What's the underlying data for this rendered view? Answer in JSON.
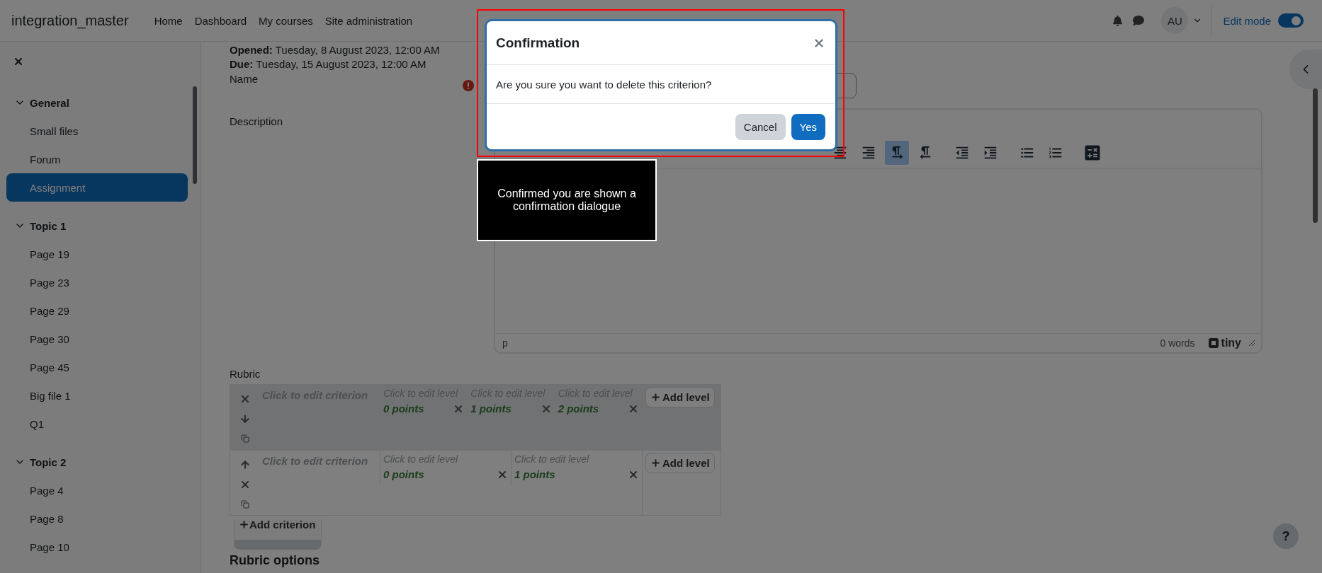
{
  "header": {
    "site_name": "integration_master",
    "nav": [
      "Home",
      "Dashboard",
      "My courses",
      "Site administration"
    ],
    "avatar_initials": "AU",
    "edit_mode": {
      "label": "Edit mode",
      "on": true
    }
  },
  "sidebar": {
    "sections": [
      {
        "title": "General",
        "expanded": true,
        "items": [
          {
            "label": "Small files",
            "selected": false
          },
          {
            "label": "Forum",
            "selected": false
          },
          {
            "label": "Assignment",
            "selected": true
          }
        ]
      },
      {
        "title": "Topic 1",
        "expanded": true,
        "items": [
          {
            "label": "Page 19",
            "selected": false
          },
          {
            "label": "Page 23",
            "selected": false
          },
          {
            "label": "Page 29",
            "selected": false
          },
          {
            "label": "Page 30",
            "selected": false
          },
          {
            "label": "Page 45",
            "selected": false
          },
          {
            "label": "Big file 1",
            "selected": false
          },
          {
            "label": "Q1",
            "selected": false
          }
        ]
      },
      {
        "title": "Topic 2",
        "expanded": true,
        "items": [
          {
            "label": "Page 4",
            "selected": false
          },
          {
            "label": "Page 8",
            "selected": false
          },
          {
            "label": "Page 10",
            "selected": false
          }
        ]
      }
    ]
  },
  "dates": [
    "**Opened:** Tuesday, 8 August 2023, 12:00 AM",
    "**Due:** Tuesday, 15 August 2023, 12:00 AM"
  ],
  "form": {
    "name_label": "Name",
    "name_error": true,
    "description_label": "Description",
    "editor": {
      "toolbar": [
        {
          "kind": "align-center",
          "selected": false
        },
        {
          "kind": "align-right",
          "selected": false
        },
        {
          "kind": "ltr",
          "selected": true
        },
        {
          "kind": "rtl",
          "selected": false
        },
        {
          "kind": "outdent",
          "selected": false
        },
        {
          "kind": "indent",
          "selected": false
        },
        {
          "kind": "bullet-list",
          "selected": false
        },
        {
          "kind": "numbered-list",
          "selected": false
        },
        {
          "kind": "calculator",
          "selected": false
        }
      ],
      "path": "p",
      "word_count": "0 words",
      "brand": "tiny"
    }
  },
  "rubric": {
    "label": "Rubric",
    "criteria": [
      {
        "text": "Click to edit criterion",
        "highlighted": true,
        "levels": [
          {
            "definition": "Click to edit level",
            "points": "0 points"
          },
          {
            "definition": "Click to edit level",
            "points": "1 points"
          },
          {
            "definition": "Click to edit level",
            "points": "2 points"
          }
        ],
        "add_level": "Add level"
      },
      {
        "text": "Click to edit criterion",
        "highlighted": false,
        "levels": [
          {
            "definition": "Click to edit level",
            "points": "0 points"
          },
          {
            "definition": "Click to edit level",
            "points": "1 points"
          }
        ],
        "add_level": "Add level"
      }
    ],
    "add_criterion": "Add criterion",
    "options_heading": "Rubric options"
  },
  "help": "?",
  "dialog": {
    "title": "Confirmation",
    "message": "Are you sure you want to delete this criterion?",
    "buttons": [
      {
        "label": "Cancel",
        "kind": "secondary"
      },
      {
        "label": "Yes",
        "kind": "primary"
      }
    ]
  },
  "caption": "Confirmed you are shown a confirmation dialogue"
}
